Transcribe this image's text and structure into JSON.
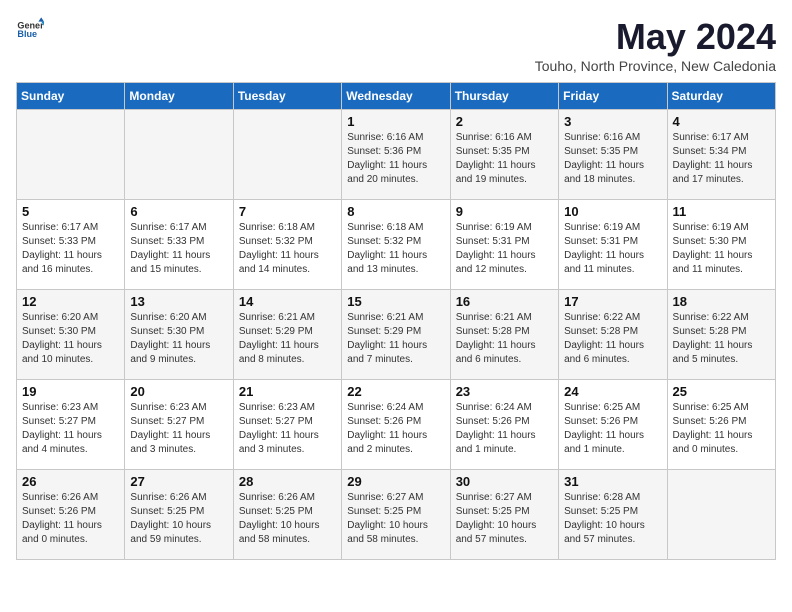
{
  "header": {
    "logo_general": "General",
    "logo_blue": "Blue",
    "month_year": "May 2024",
    "location": "Touho, North Province, New Caledonia"
  },
  "weekdays": [
    "Sunday",
    "Monday",
    "Tuesday",
    "Wednesday",
    "Thursday",
    "Friday",
    "Saturday"
  ],
  "weeks": [
    [
      {
        "day": "",
        "sunrise": "",
        "sunset": "",
        "daylight": ""
      },
      {
        "day": "",
        "sunrise": "",
        "sunset": "",
        "daylight": ""
      },
      {
        "day": "",
        "sunrise": "",
        "sunset": "",
        "daylight": ""
      },
      {
        "day": "1",
        "sunrise": "Sunrise: 6:16 AM",
        "sunset": "Sunset: 5:36 PM",
        "daylight": "Daylight: 11 hours and 20 minutes."
      },
      {
        "day": "2",
        "sunrise": "Sunrise: 6:16 AM",
        "sunset": "Sunset: 5:35 PM",
        "daylight": "Daylight: 11 hours and 19 minutes."
      },
      {
        "day": "3",
        "sunrise": "Sunrise: 6:16 AM",
        "sunset": "Sunset: 5:35 PM",
        "daylight": "Daylight: 11 hours and 18 minutes."
      },
      {
        "day": "4",
        "sunrise": "Sunrise: 6:17 AM",
        "sunset": "Sunset: 5:34 PM",
        "daylight": "Daylight: 11 hours and 17 minutes."
      }
    ],
    [
      {
        "day": "5",
        "sunrise": "Sunrise: 6:17 AM",
        "sunset": "Sunset: 5:33 PM",
        "daylight": "Daylight: 11 hours and 16 minutes."
      },
      {
        "day": "6",
        "sunrise": "Sunrise: 6:17 AM",
        "sunset": "Sunset: 5:33 PM",
        "daylight": "Daylight: 11 hours and 15 minutes."
      },
      {
        "day": "7",
        "sunrise": "Sunrise: 6:18 AM",
        "sunset": "Sunset: 5:32 PM",
        "daylight": "Daylight: 11 hours and 14 minutes."
      },
      {
        "day": "8",
        "sunrise": "Sunrise: 6:18 AM",
        "sunset": "Sunset: 5:32 PM",
        "daylight": "Daylight: 11 hours and 13 minutes."
      },
      {
        "day": "9",
        "sunrise": "Sunrise: 6:19 AM",
        "sunset": "Sunset: 5:31 PM",
        "daylight": "Daylight: 11 hours and 12 minutes."
      },
      {
        "day": "10",
        "sunrise": "Sunrise: 6:19 AM",
        "sunset": "Sunset: 5:31 PM",
        "daylight": "Daylight: 11 hours and 11 minutes."
      },
      {
        "day": "11",
        "sunrise": "Sunrise: 6:19 AM",
        "sunset": "Sunset: 5:30 PM",
        "daylight": "Daylight: 11 hours and 11 minutes."
      }
    ],
    [
      {
        "day": "12",
        "sunrise": "Sunrise: 6:20 AM",
        "sunset": "Sunset: 5:30 PM",
        "daylight": "Daylight: 11 hours and 10 minutes."
      },
      {
        "day": "13",
        "sunrise": "Sunrise: 6:20 AM",
        "sunset": "Sunset: 5:30 PM",
        "daylight": "Daylight: 11 hours and 9 minutes."
      },
      {
        "day": "14",
        "sunrise": "Sunrise: 6:21 AM",
        "sunset": "Sunset: 5:29 PM",
        "daylight": "Daylight: 11 hours and 8 minutes."
      },
      {
        "day": "15",
        "sunrise": "Sunrise: 6:21 AM",
        "sunset": "Sunset: 5:29 PM",
        "daylight": "Daylight: 11 hours and 7 minutes."
      },
      {
        "day": "16",
        "sunrise": "Sunrise: 6:21 AM",
        "sunset": "Sunset: 5:28 PM",
        "daylight": "Daylight: 11 hours and 6 minutes."
      },
      {
        "day": "17",
        "sunrise": "Sunrise: 6:22 AM",
        "sunset": "Sunset: 5:28 PM",
        "daylight": "Daylight: 11 hours and 6 minutes."
      },
      {
        "day": "18",
        "sunrise": "Sunrise: 6:22 AM",
        "sunset": "Sunset: 5:28 PM",
        "daylight": "Daylight: 11 hours and 5 minutes."
      }
    ],
    [
      {
        "day": "19",
        "sunrise": "Sunrise: 6:23 AM",
        "sunset": "Sunset: 5:27 PM",
        "daylight": "Daylight: 11 hours and 4 minutes."
      },
      {
        "day": "20",
        "sunrise": "Sunrise: 6:23 AM",
        "sunset": "Sunset: 5:27 PM",
        "daylight": "Daylight: 11 hours and 3 minutes."
      },
      {
        "day": "21",
        "sunrise": "Sunrise: 6:23 AM",
        "sunset": "Sunset: 5:27 PM",
        "daylight": "Daylight: 11 hours and 3 minutes."
      },
      {
        "day": "22",
        "sunrise": "Sunrise: 6:24 AM",
        "sunset": "Sunset: 5:26 PM",
        "daylight": "Daylight: 11 hours and 2 minutes."
      },
      {
        "day": "23",
        "sunrise": "Sunrise: 6:24 AM",
        "sunset": "Sunset: 5:26 PM",
        "daylight": "Daylight: 11 hours and 1 minute."
      },
      {
        "day": "24",
        "sunrise": "Sunrise: 6:25 AM",
        "sunset": "Sunset: 5:26 PM",
        "daylight": "Daylight: 11 hours and 1 minute."
      },
      {
        "day": "25",
        "sunrise": "Sunrise: 6:25 AM",
        "sunset": "Sunset: 5:26 PM",
        "daylight": "Daylight: 11 hours and 0 minutes."
      }
    ],
    [
      {
        "day": "26",
        "sunrise": "Sunrise: 6:26 AM",
        "sunset": "Sunset: 5:26 PM",
        "daylight": "Daylight: 11 hours and 0 minutes."
      },
      {
        "day": "27",
        "sunrise": "Sunrise: 6:26 AM",
        "sunset": "Sunset: 5:25 PM",
        "daylight": "Daylight: 10 hours and 59 minutes."
      },
      {
        "day": "28",
        "sunrise": "Sunrise: 6:26 AM",
        "sunset": "Sunset: 5:25 PM",
        "daylight": "Daylight: 10 hours and 58 minutes."
      },
      {
        "day": "29",
        "sunrise": "Sunrise: 6:27 AM",
        "sunset": "Sunset: 5:25 PM",
        "daylight": "Daylight: 10 hours and 58 minutes."
      },
      {
        "day": "30",
        "sunrise": "Sunrise: 6:27 AM",
        "sunset": "Sunset: 5:25 PM",
        "daylight": "Daylight: 10 hours and 57 minutes."
      },
      {
        "day": "31",
        "sunrise": "Sunrise: 6:28 AM",
        "sunset": "Sunset: 5:25 PM",
        "daylight": "Daylight: 10 hours and 57 minutes."
      },
      {
        "day": "",
        "sunrise": "",
        "sunset": "",
        "daylight": ""
      }
    ]
  ]
}
